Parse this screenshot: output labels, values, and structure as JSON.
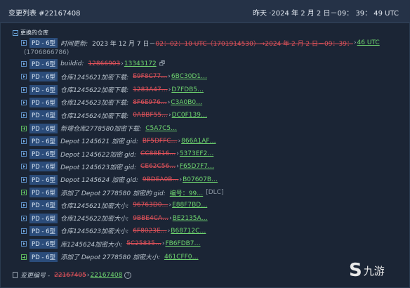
{
  "header": {
    "title": "变更列表 #22167408",
    "time": "昨天 ·2024 年 2 月 2 日－09： 39： 49 UTC"
  },
  "section": {
    "label": "更换的仓库"
  },
  "rows": [
    {
      "icon": "play",
      "tag": "PD - 6型",
      "label": "时间更新:",
      "plain": "2023 年 12 月 7 日－",
      "old": "02：02：10 UTC（1701914530）→2024 年 2 月 2 日－09：39：",
      "new": "46 UTC",
      "extra": "(1706866786)"
    },
    {
      "icon": "play",
      "tag": "PD - 6型",
      "label": "buildid:",
      "old": "12866903",
      "new": "13343172",
      "suffix": "🗗"
    },
    {
      "icon": "play",
      "tag": "PD - 6型",
      "label": "仓库1245621加密下载:",
      "old": "E9F8C77…",
      "new": "6BC30D1…"
    },
    {
      "icon": "play",
      "tag": "PD - 6型",
      "label": "仓库1245622加密下载:",
      "old": "1283A47…",
      "new": "D7FDB5…"
    },
    {
      "icon": "play",
      "tag": "PD - 6型",
      "label": "仓库1245623加密下载:",
      "old": "8F6E976…",
      "new": "C3A0B0…"
    },
    {
      "icon": "play",
      "tag": "PD - 6型",
      "label": "仓库1245624加密下载:",
      "old": "0ABBF55…",
      "new": "DC0F139…"
    },
    {
      "icon": "plus",
      "tag": "PD - 6型",
      "label": "新增仓库2778580加密下载:",
      "new": "C5A7C5…"
    },
    {
      "icon": "play",
      "tag": "PD - 6型",
      "label": "Depot 1245621 加密 gid:",
      "old": "BF5DFFC…",
      "new": "866A1AF…"
    },
    {
      "icon": "play",
      "tag": "PD - 6型",
      "label": "Depot 1245622加密 gid:",
      "old": "CC88E16…",
      "new": "5373EF2…"
    },
    {
      "icon": "play",
      "tag": "PD - 6型",
      "label": "Depot 1245623加密 gid:",
      "old": "CE62C56…",
      "new": "F65D7F7…"
    },
    {
      "icon": "play",
      "tag": "PD - 6型",
      "label": "Depot 1245624 加密 gid:",
      "old": "9BDEA0B…",
      "new": "B07607B…"
    },
    {
      "icon": "plus",
      "tag": "PD - 6型",
      "label": "添加了 Depot 2778580 加密的 gid:",
      "new": "编号：99…",
      "suffix": "[DLC]"
    },
    {
      "icon": "play",
      "tag": "PD - 6型",
      "label": "仓库1245621加密大小:",
      "old": "96763D0…",
      "new": "E88F7BD…"
    },
    {
      "icon": "play",
      "tag": "PD - 6型",
      "label": "仓库1245622加密大小:",
      "old": "9BBE4CA…",
      "new": "BE2135A…"
    },
    {
      "icon": "play",
      "tag": "PD - 6型",
      "label": "仓库1245623加密大小:",
      "old": "6F8023E…",
      "new": "B68712C…"
    },
    {
      "icon": "play",
      "tag": "PD - 6型",
      "label": "库1245624加密大小:",
      "old": "5C25835…",
      "new": "FB6FDB7…"
    },
    {
      "icon": "plus",
      "tag": "PD - 6型",
      "label": "添加了 Depot 2778580 加密大小:",
      "new": "461CFF0…"
    }
  ],
  "footer": {
    "label": "变更编号 -",
    "old": "22167405",
    "new": "22167408",
    "help": "?"
  },
  "logo": {
    "mark": "S",
    "text": "九游"
  }
}
